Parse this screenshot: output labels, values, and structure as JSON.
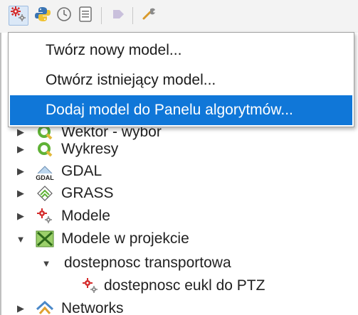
{
  "toolbar": {
    "icons": [
      "models-icon",
      "python-icon",
      "history-icon",
      "results-icon",
      "toggle-icon",
      "options-icon"
    ]
  },
  "menu": {
    "items": [
      {
        "label": "Twórz nowy model..."
      },
      {
        "label": "Otwórz istniejący model..."
      },
      {
        "label": "Dodaj model do Panelu algorytmów..."
      }
    ]
  },
  "tree": {
    "items": [
      {
        "label": "Wektor - wybór"
      },
      {
        "label": "Wykresy"
      },
      {
        "label": "GDAL"
      },
      {
        "label": "GRASS"
      },
      {
        "label": "Modele"
      },
      {
        "label": "Modele w projekcie"
      },
      {
        "label": "dostepnosc transportowa"
      },
      {
        "label": "dostepnosc eukl do PTZ"
      },
      {
        "label": "Networks"
      }
    ]
  },
  "colors": {
    "highlight": "#1077d8",
    "qgis_green": "#5fb236",
    "toolbar_bg": "#f3f3f3"
  }
}
